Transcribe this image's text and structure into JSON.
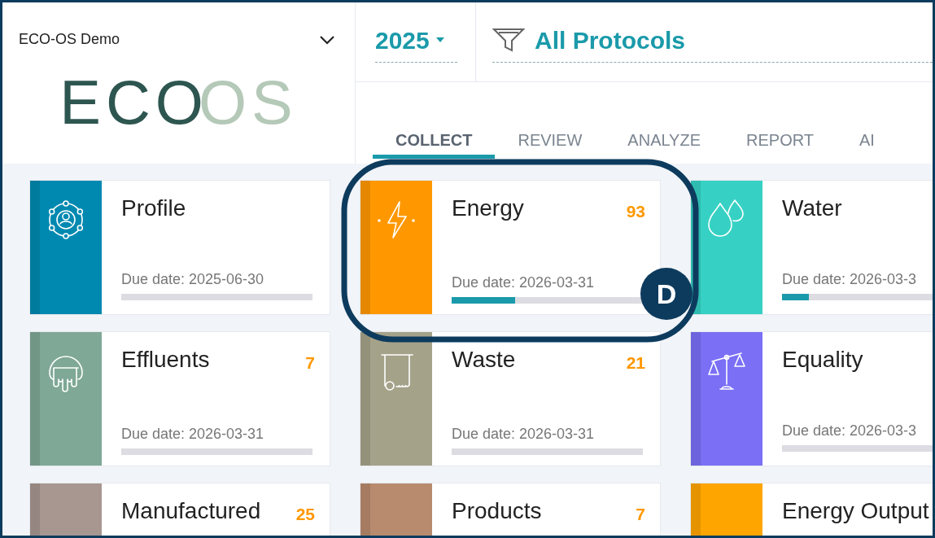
{
  "sidebar": {
    "organization": "ECO-OS Demo",
    "logo": {
      "dark": "ECO",
      "light": "OS"
    }
  },
  "header": {
    "year": "2025",
    "filter": "All Protocols"
  },
  "tabs": [
    {
      "label": "COLLECT",
      "selected": true
    },
    {
      "label": "REVIEW",
      "selected": false
    },
    {
      "label": "ANALYZE",
      "selected": false
    },
    {
      "label": "REPORT",
      "selected": false
    },
    {
      "label": "AI",
      "selected": false
    }
  ],
  "cards": [
    {
      "title": "Profile",
      "due": "Due date: 2025-06-30",
      "level": 0,
      "color": "#0089b0"
    },
    {
      "title": "Energy",
      "count": "93",
      "due": "Due date: 2026-03-31",
      "level": 0.33,
      "color": "#ff9800"
    },
    {
      "title": "Water",
      "due": "Due date: 2026-03-3",
      "level": 0.14,
      "color": "#36d1c4"
    },
    {
      "title": "Effluents",
      "count": "7",
      "due": "Due date: 2026-03-31",
      "level": 0,
      "color": "#7fa896"
    },
    {
      "title": "Waste",
      "count": "21",
      "due": "Due date: 2026-03-31",
      "level": 0,
      "color": "#a5a28a"
    },
    {
      "title": "Equality",
      "due": "Due date: 2026-03-3",
      "level": 0,
      "color": "#7a6ff5"
    },
    {
      "title": "Manufactured",
      "count": "25",
      "color": "#a89690"
    },
    {
      "title": "Products",
      "count": "7",
      "color": "#b88b6e"
    },
    {
      "title": "Energy Output",
      "color": "#ffa500"
    }
  ],
  "callout": {
    "badge": "D"
  }
}
